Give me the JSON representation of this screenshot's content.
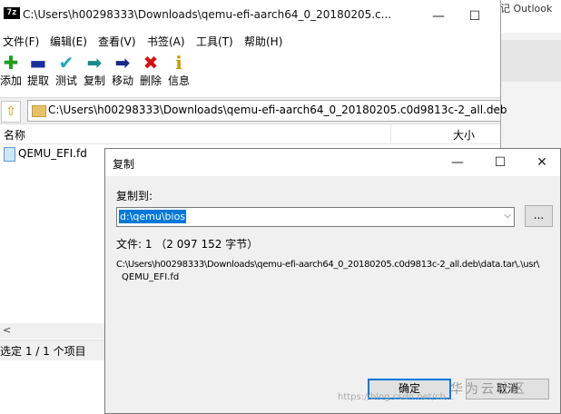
{
  "background_app": {
    "title_fragment": "记 Outlook"
  },
  "window": {
    "app_icon": "7z",
    "title": "C:\\Users\\h00298333\\Downloads\\qemu-efi-aarch64_0_20180205.c...",
    "minimize_glyph": "—",
    "maximize_glyph": "☐",
    "close_glyph": "✕"
  },
  "menu": [
    "文件(F)",
    "编辑(E)",
    "查看(V)",
    "书签(A)",
    "工具(T)",
    "帮助(H)"
  ],
  "toolbar": [
    {
      "label": "添加",
      "icon": "add-icon",
      "glyph": "✚",
      "color": "#1e9e1e"
    },
    {
      "label": "提取",
      "icon": "extract-icon",
      "glyph": "▬",
      "color": "#1a2f9e"
    },
    {
      "label": "测试",
      "icon": "test-icon",
      "glyph": "✔",
      "color": "#22a7b8"
    },
    {
      "label": "复制",
      "icon": "copy-icon",
      "glyph": "➡",
      "color": "#1a8a8a"
    },
    {
      "label": "移动",
      "icon": "move-icon",
      "glyph": "➡",
      "color": "#1a2a8a"
    },
    {
      "label": "删除",
      "icon": "delete-icon",
      "glyph": "✖",
      "color": "#d01010"
    },
    {
      "label": "信息",
      "icon": "info-icon",
      "glyph": "i",
      "color": "#c89a00"
    }
  ],
  "address": {
    "path": "C:\\Users\\h00298333\\Downloads\\qemu-efi-aarch64_0_20180205.c0d9813c-2_all.deb",
    "up_glyph": "⇧",
    "dropdown_glyph": "⌵"
  },
  "columns": {
    "name": "名称",
    "size": "大小"
  },
  "files": [
    {
      "name": "QEMU_EFI.fd"
    }
  ],
  "scroll_left_glyph": "<",
  "status": "选定 1 / 1 个项目",
  "dialog": {
    "title": "复制",
    "minimize_glyph": "—",
    "maximize_glyph": "☐",
    "close_glyph": "✕",
    "copy_to_label": "复制到:",
    "destination": "d:\\qemu\\bios",
    "dropdown_glyph": "⌵",
    "browse_label": "...",
    "files_info": "文件: 1 （2 097 152 字节）",
    "source_line1": "C:\\Users\\h00298333\\Downloads\\qemu-efi-aarch64_0_20180205.c0d9813c-2_all.deb\\data.tar\\.\\usr\\",
    "source_line2": "QEMU_EFI.fd",
    "ok_label": "确定",
    "cancel_label": "取消"
  },
  "watermark": {
    "brand": "华为云社区",
    "url": "https://blog.csdn.net/cb..."
  }
}
